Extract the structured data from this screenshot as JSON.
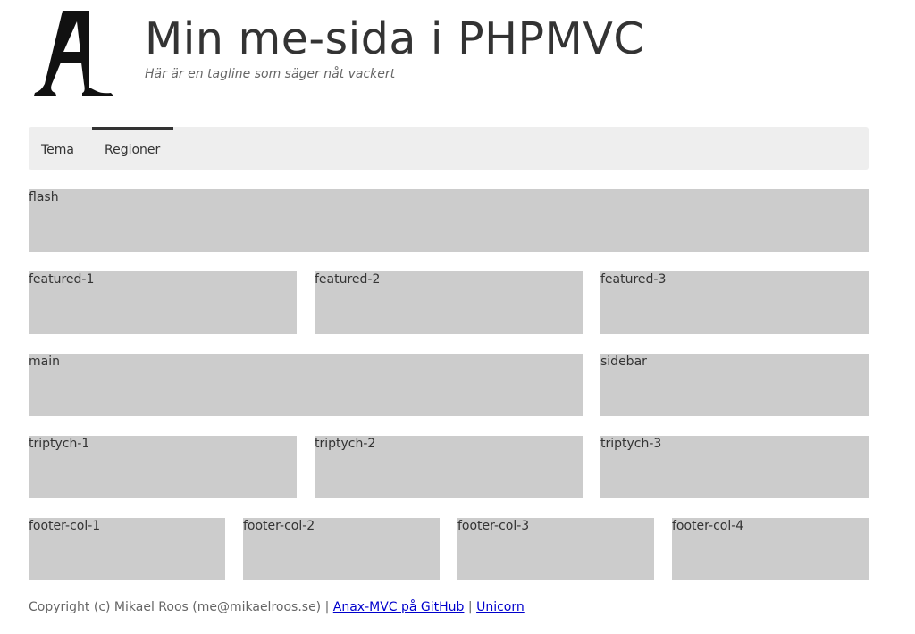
{
  "header": {
    "logo_icon": "stencil-letter-a-logo",
    "title": "Min me-sida i PHPMVC",
    "slogan": "Här är en tagline som säger nåt vackert"
  },
  "navbar": {
    "items": [
      {
        "label": "Tema",
        "active": false
      },
      {
        "label": "Regioner",
        "active": true
      }
    ]
  },
  "regions": {
    "flash": "flash",
    "featured_1": "featured-1",
    "featured_2": "featured-2",
    "featured_3": "featured-3",
    "main": "main",
    "sidebar": "sidebar",
    "triptych_1": "triptych-1",
    "triptych_2": "triptych-2",
    "triptych_3": "triptych-3",
    "footer_col_1": "footer-col-1",
    "footer_col_2": "footer-col-2",
    "footer_col_3": "footer-col-3",
    "footer_col_4": "footer-col-4"
  },
  "footer": {
    "copyright": "Copyright (c) Mikael Roos (me@mikaelroos.se) | ",
    "link_github": "Anax-MVC på GitHub",
    "separator": " | ",
    "link_unicorn": "Unicorn"
  },
  "colors": {
    "region_bg": "#cccccc",
    "navbar_bg": "#eeeeee",
    "text": "#333333",
    "link": "#0000cc"
  }
}
